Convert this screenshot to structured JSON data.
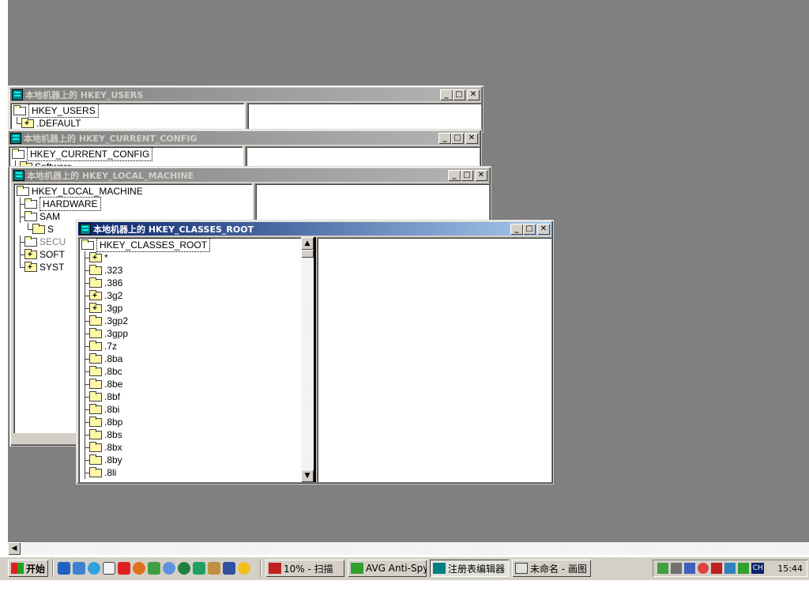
{
  "windows": {
    "users": {
      "title": "本地机器上的 HKEY_USERS",
      "root": "HKEY_USERS",
      "children": [
        ".DEFAULT"
      ]
    },
    "current_config": {
      "title": "本地机器上的 HKEY_CURRENT_CONFIG",
      "root": "HKEY_CURRENT_CONFIG",
      "children": [
        "Software"
      ]
    },
    "local_machine": {
      "title": "本地机器上的 HKEY_LOCAL_MACHINE",
      "root": "HKEY_LOCAL_MACHINE",
      "children": [
        "HARDWARE",
        "SAM",
        "SECU",
        "SOFT",
        "SYST"
      ],
      "sam_child": "S"
    },
    "classes_root": {
      "title": "本地机器上的 HKEY_CLASSES_ROOT",
      "root": "HKEY_CLASSES_ROOT",
      "children": [
        "*",
        ".323",
        ".386",
        ".3g2",
        ".3gp",
        ".3gp2",
        ".3gpp",
        ".7z",
        ".8ba",
        ".8bc",
        ".8be",
        ".8bf",
        ".8bi",
        ".8bp",
        ".8bs",
        ".8bx",
        ".8by",
        ".8li"
      ]
    }
  },
  "buttons": {
    "minimize": "_",
    "maximize": "□",
    "close": "✕"
  },
  "taskbar": {
    "start_label": "开始",
    "tasks": [
      "10% - 扫描",
      "AVG Anti-Spy...",
      "注册表编辑器",
      "未命名 - 画图"
    ],
    "lang": "CH",
    "clock": "15:44"
  },
  "colors": {
    "desktop": "#808080",
    "active_title": "#0a246a",
    "inactive_title": "#808080"
  }
}
